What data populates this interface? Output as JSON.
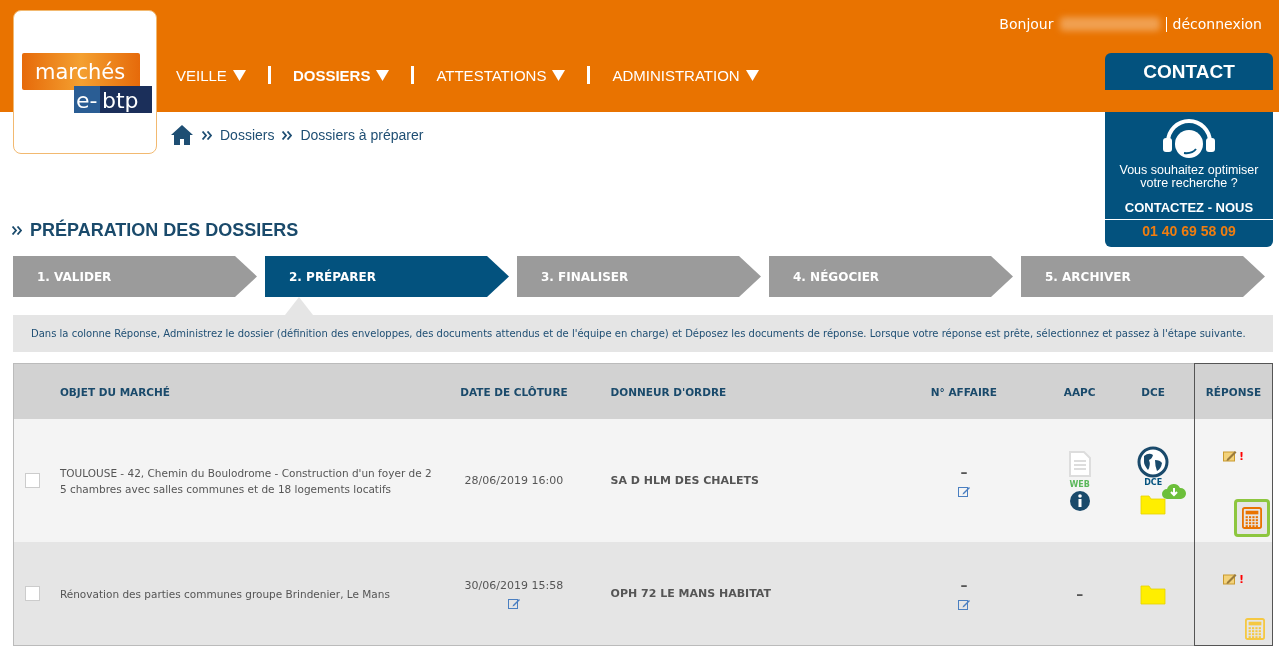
{
  "header": {
    "greeting": "Bonjour",
    "logout": "déconnexion",
    "logo": {
      "top": "marchés",
      "bottom_left": "e-",
      "bottom_right": "btp"
    },
    "nav": [
      {
        "label": "VEILLE",
        "selected": false
      },
      {
        "label": "DOSSIERS",
        "selected": true
      },
      {
        "label": "ATTESTATIONS",
        "selected": false
      },
      {
        "label": "ADMINISTRATION",
        "selected": false
      }
    ]
  },
  "breadcrumb": [
    "Dossiers",
    "Dossiers à préparer"
  ],
  "contact": {
    "title": "CONTACT",
    "text": "Vous souhaitez optimiser votre recherche ?",
    "cta": "CONTACTEZ - NOUS",
    "phone": "01 40 69 58 09"
  },
  "page_title": "PRÉPARATION DES DOSSIERS",
  "steps": [
    {
      "label": "1. VALIDER",
      "selected": false
    },
    {
      "label": "2. PRÉPARER",
      "selected": true
    },
    {
      "label": "3. FINALISER",
      "selected": false
    },
    {
      "label": "4. NÉGOCIER",
      "selected": false
    },
    {
      "label": "5. ARCHIVER",
      "selected": false
    }
  ],
  "info": "Dans la colonne Réponse, Administrez le dossier (définition des enveloppes, des documents attendus et de l'équipe en charge) et Déposez les documents de réponse. Lorsque votre réponse est prête, sélectionnez et passez à l'étape suivante.",
  "table": {
    "columns": [
      "OBJET DU MARCHÉ",
      "DATE DE CLÔTURE",
      "DONNEUR D'ORDRE",
      "N° AFFAIRE",
      "AAPC",
      "DCE",
      "RÉPONSE"
    ],
    "rows": [
      {
        "checked": false,
        "objet": "TOULOUSE - 42, Chemin du Boulodrome - Construction d'un foyer de 2 5 chambres avec salles communes et de 18 logements locatifs",
        "date": "28/06/2019 16:00",
        "date_editable": false,
        "donneur": "SA D HLM DES CHALETS",
        "affaire": "–",
        "aapc": {
          "kind": "web",
          "label": "WEB"
        },
        "dce": {
          "online": true,
          "label": "DCE"
        },
        "reponse_mark": "!",
        "calculator_highlighted": true
      },
      {
        "checked": false,
        "objet": "Rénovation des parties communes groupe Brindenier, Le Mans",
        "date": "30/06/2019 15:58",
        "date_editable": true,
        "donneur": "OPH 72 LE MANS HABITAT",
        "affaire": "–",
        "aapc": {
          "kind": "none",
          "label": "–"
        },
        "dce": {
          "online": false
        },
        "reponse_mark": "!",
        "calculator_highlighted": false
      }
    ]
  }
}
